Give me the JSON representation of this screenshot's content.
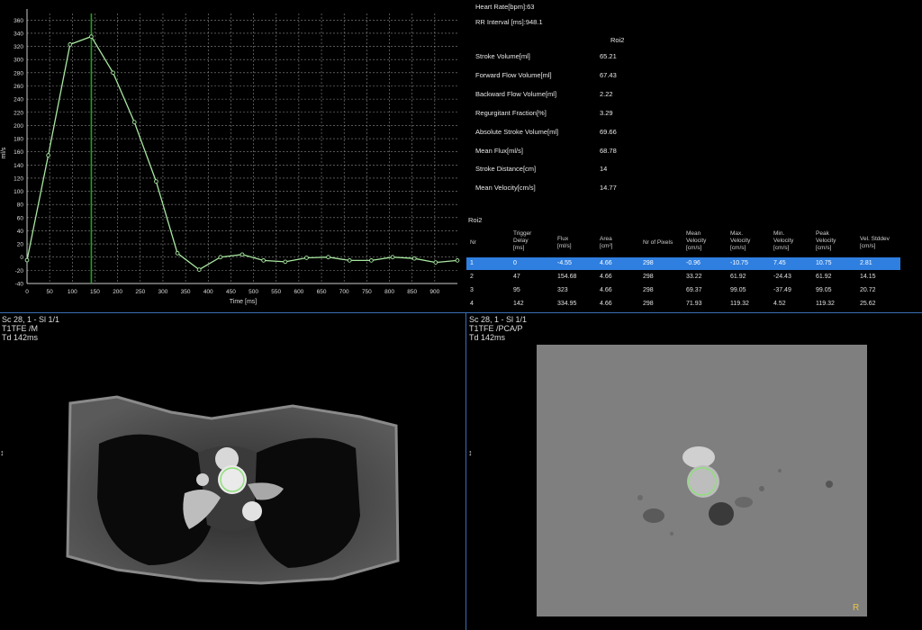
{
  "chart_data": {
    "type": "line",
    "x": [
      0,
      47,
      95,
      142,
      190,
      237,
      285,
      332,
      380,
      427,
      475,
      522,
      570,
      617,
      665,
      712,
      760,
      807,
      855,
      902,
      950
    ],
    "y": [
      -4.55,
      154.68,
      323,
      334.95,
      280,
      205,
      115,
      6,
      -19,
      0,
      4,
      -5,
      -7,
      -1,
      0,
      -5,
      -5,
      0,
      -2,
      -8,
      -5
    ],
    "xlabel": "Time [ms]",
    "ylabel": "ml/s",
    "xlim": [
      0,
      950
    ],
    "ylim": [
      -40,
      370
    ],
    "x_ticks": [
      "0",
      "50",
      "100",
      "150",
      "200",
      "250",
      "300",
      "350",
      "400",
      "450",
      "500",
      "550",
      "600",
      "650",
      "700",
      "750",
      "800",
      "850",
      "900"
    ],
    "y_ticks": [
      "-40",
      "-20",
      "0",
      "20",
      "40",
      "60",
      "80",
      "100",
      "120",
      "140",
      "160",
      "180",
      "200",
      "220",
      "240",
      "260",
      "280",
      "300",
      "320",
      "340",
      "360"
    ],
    "marker_x": 142,
    "grid": true,
    "line_color": "#a8e8a0",
    "marker_color": "#1fa31f"
  },
  "summary": {
    "heart_rate": "Heart Rate[bpm]:63",
    "rr_interval": "RR Interval [ms]:948.1",
    "roi_header": "Roi2",
    "rows": [
      {
        "label": "Stroke Volume[ml]",
        "value": "65.21"
      },
      {
        "label": "Forward Flow Volume[ml]",
        "value": "67.43"
      },
      {
        "label": "Backward Flow Volume[ml]",
        "value": "2.22"
      },
      {
        "label": "Regurgitant Fraction[%]",
        "value": "3.29"
      },
      {
        "label": "Absolute Stroke Volume[ml]",
        "value": "69.66"
      },
      {
        "label": "Mean Flux[ml/s]",
        "value": "68.78"
      },
      {
        "label": "Stroke Distance[cm]",
        "value": "14"
      },
      {
        "label": "Mean Velocity[cm/s]",
        "value": "14.77"
      }
    ]
  },
  "table": {
    "title": "Roi2",
    "headers": [
      "Nr",
      "Trigger\nDelay\n[ms]",
      "Flux\n[ml/s]",
      "Area\n[cm²]",
      "Nr of Pixels",
      "Mean\nVelocity\n[cm/s]",
      "Max.\nVelocity\n[cm/s]",
      "Min.\nVelocity\n[cm/s]",
      "Peak\nVelocity\n[cm/s]",
      "Vel. Stddev\n[cm/s]"
    ],
    "rows": [
      [
        "1",
        "0",
        "-4.55",
        "4.66",
        "298",
        "-0.96",
        "-10.75",
        "7.45",
        "10.75",
        "2.81"
      ],
      [
        "2",
        "47",
        "154.68",
        "4.66",
        "298",
        "33.22",
        "61.92",
        "-24.43",
        "61.92",
        "14.15"
      ],
      [
        "3",
        "95",
        "323",
        "4.66",
        "298",
        "69.37",
        "99.05",
        "-37.49",
        "99.05",
        "20.72"
      ],
      [
        "4",
        "142",
        "334.95",
        "4.66",
        "298",
        "71.93",
        "119.32",
        "4.52",
        "119.32",
        "25.62"
      ]
    ],
    "selected_row": 0,
    "selection_color": "#2f7fe0"
  },
  "viewport_left": {
    "line1": "Sc 28, 1 - Sl 1/1",
    "line2": "T1TFE   /M",
    "line3": "Td 142ms",
    "side_marker": "↕"
  },
  "viewport_right": {
    "line1": "Sc 28, 1 - Sl 1/1",
    "line2": "T1TFE   /PCA/P",
    "line3": "Td 142ms",
    "side_marker": "↕",
    "orientation": "R"
  },
  "colors": {
    "separator": "#3a6fb5",
    "roi_circle": "#8ee07a",
    "orientation_label": "#e8c64a"
  }
}
